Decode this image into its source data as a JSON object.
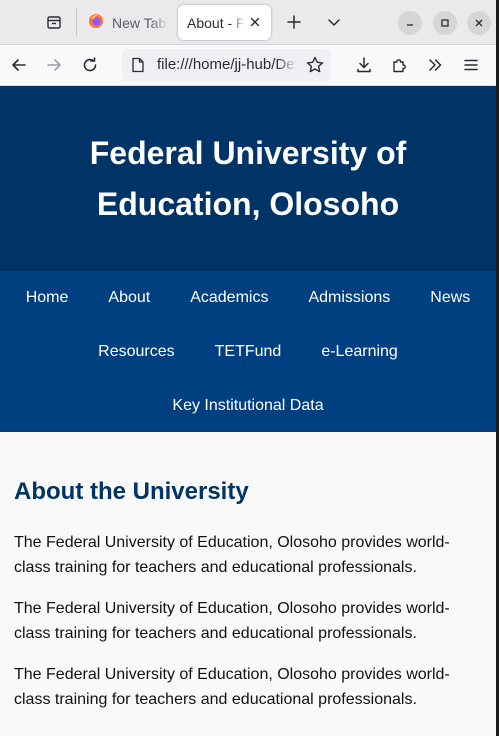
{
  "browser": {
    "tabs": [
      {
        "label": "New Tab"
      },
      {
        "label": "About - Federal University of Education, Olosoho"
      }
    ],
    "url": "file:///home/jj-hub/Desktop/about.html"
  },
  "site": {
    "title": "Federal University of Education, Olosoho",
    "nav": [
      {
        "label": "Home"
      },
      {
        "label": "About"
      },
      {
        "label": "Academics"
      },
      {
        "label": "Admissions"
      },
      {
        "label": "News"
      },
      {
        "label": "Resources"
      },
      {
        "label": "TETFund"
      },
      {
        "label": "e-Learning"
      },
      {
        "label": "Key Institutional Data"
      }
    ],
    "heading": "About the University",
    "paragraphs": [
      "The Federal University of Education, Olosoho provides world-class training for teachers and educational professionals.",
      "The Federal University of Education, Olosoho provides world-class training for teachers and educational professionals.",
      "The Federal University of Education, Olosoho provides world-class training for teachers and educational professionals."
    ]
  },
  "colors": {
    "header_bg": "#003366",
    "nav_bg": "#004080",
    "heading": "#003366"
  }
}
